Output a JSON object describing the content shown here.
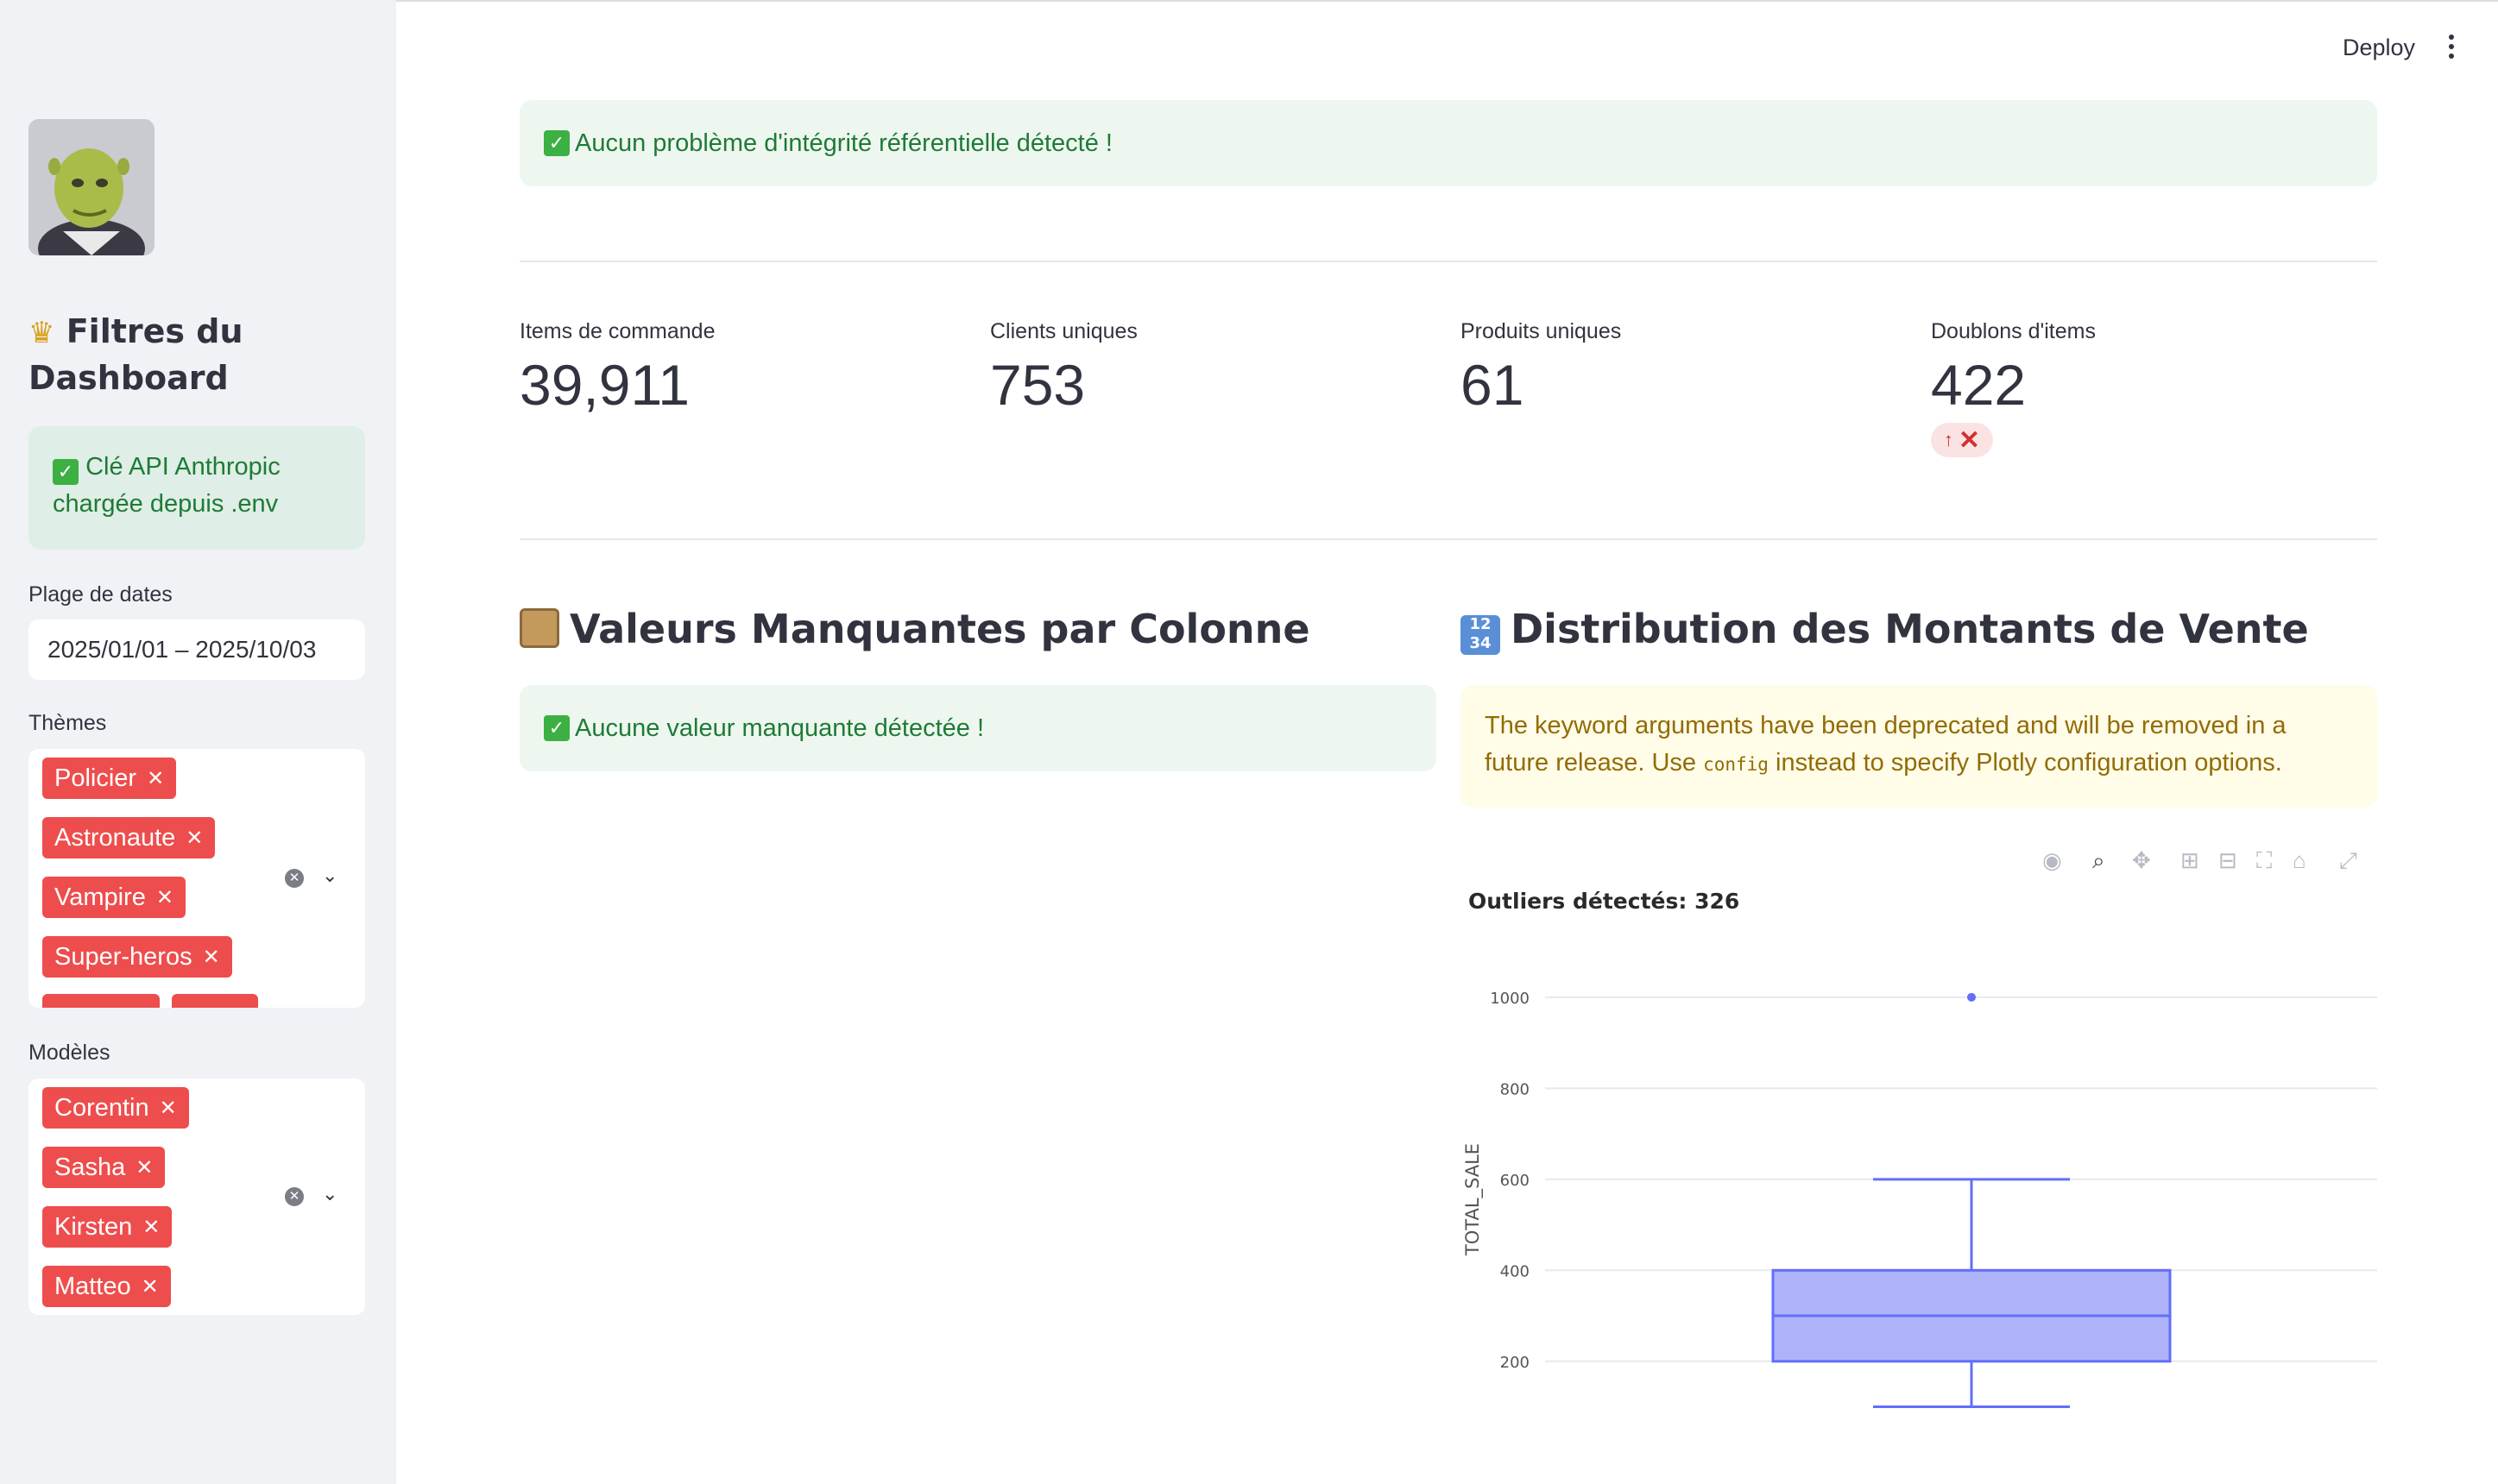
{
  "header": {
    "deploy_label": "Deploy"
  },
  "sidebar": {
    "title": "Filtres du Dashboard",
    "api_status": "Clé API Anthropic chargée depuis .env",
    "date_label": "Plage de dates",
    "date_value": "2025/01/01 – 2025/10/03",
    "themes_label": "Thèmes",
    "themes": [
      "Policier",
      "Astronaute",
      "Vampire",
      "Super-heros"
    ],
    "models_label": "Modèles",
    "models": [
      "Corentin",
      "Sasha",
      "Kirsten",
      "Matteo"
    ]
  },
  "main": {
    "integrity_status": "Aucun problème d'intégrité référentielle détecté !",
    "metrics": [
      {
        "label": "Items de commande",
        "value": "39,911"
      },
      {
        "label": "Clients uniques",
        "value": "753"
      },
      {
        "label": "Produits uniques",
        "value": "61"
      },
      {
        "label": "Doublons d'items",
        "value": "422"
      }
    ],
    "missing_title": "Valeurs Manquantes par Colonne",
    "missing_status": "Aucune valeur manquante détectée !",
    "distribution_title": "Distribution des Montants de Vente",
    "warning_part1": "The keyword arguments have been deprecated and will be removed in a future release. Use ",
    "warning_code": "config",
    "warning_part2": " instead to specify Plotly configuration options.",
    "chart_title": "Outliers détectés: 326"
  },
  "colors": {
    "accent": "#ee4d4d",
    "success_text": "#1e7b36",
    "box_fill": "#aeb2f8",
    "box_line": "#636efa"
  },
  "chart_data": {
    "type": "box",
    "title": "Outliers détectés: 326",
    "ylabel": "TOTAL_SALE",
    "xlabel": "",
    "ylim": [
      120,
      1030
    ],
    "yticks": [
      200,
      400,
      600,
      800,
      1000
    ],
    "box": {
      "min": 100,
      "q1": 200,
      "median": 300,
      "q3": 400,
      "max": 600
    },
    "outliers": [
      1000
    ]
  }
}
